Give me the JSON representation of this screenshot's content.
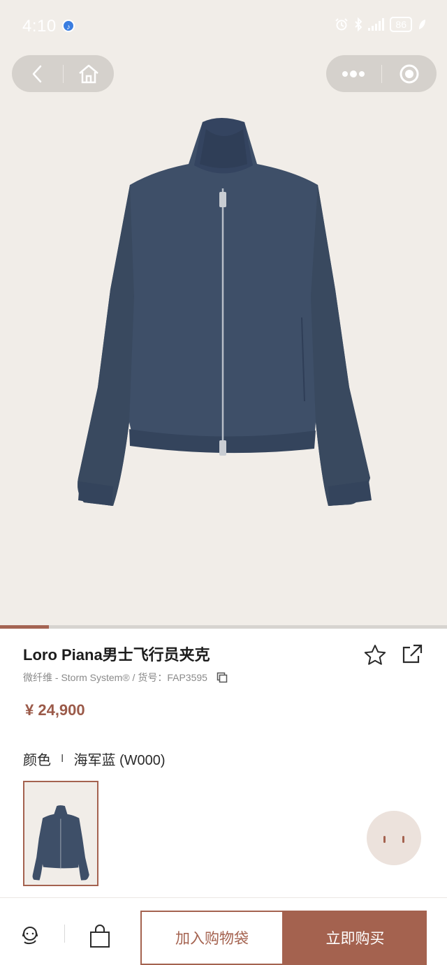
{
  "status_bar": {
    "time": "4:10",
    "battery": "86"
  },
  "gallery": {
    "progress": 0.11
  },
  "product": {
    "title": "Loro Piana男士飞行员夹克",
    "subtitle": "微纤维 - Storm System® / 货号：FAP3595",
    "price": "¥ 24,900",
    "color_label": "颜色",
    "color_sep": "I",
    "color_value": "海军蓝 (W000)"
  },
  "actions": {
    "add_to_cart": "加入购物袋",
    "buy_now": "立即购买"
  },
  "icons": {
    "back": "back-icon",
    "home": "home-icon",
    "more": "more-icon",
    "close_target": "target-icon",
    "favorite": "star-icon",
    "share": "share-icon",
    "copy": "copy-icon",
    "service": "customer-service-icon",
    "bag": "shopping-bag-icon"
  },
  "colors": {
    "accent": "#a4624f",
    "price": "#9b5a49",
    "background": "#f1ede8",
    "jacket": "#3e4f68"
  }
}
